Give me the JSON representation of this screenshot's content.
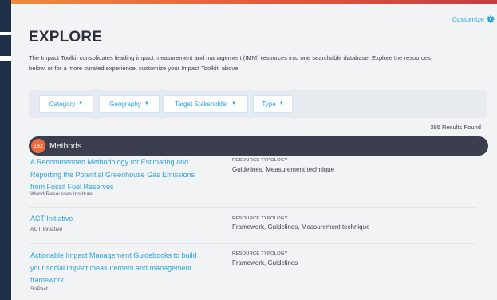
{
  "colors": {
    "accent": "#2aa3d8",
    "header_bar": "#3b3f4d",
    "badge": "#ee6b3f",
    "gradient_start": "#f08a3c",
    "gradient_end": "#c63a46"
  },
  "header": {
    "customize_label": "Customize",
    "customize_icon": "gear-icon"
  },
  "page": {
    "title": "EXPLORE",
    "intro_line1": "The Impact Toolkit consolidates leading impact measurement and management (IMM) resources into one searchable database. Explore the resources",
    "intro_line2": "below, or for a more curated experience, customize your Impact Toolkit, above."
  },
  "filters": [
    {
      "label": "Category"
    },
    {
      "label": "Geography"
    },
    {
      "label": "Target Stakeholder"
    },
    {
      "label": "Type"
    }
  ],
  "results": {
    "count_text": "395 Results Found"
  },
  "section": {
    "count": "182",
    "title": "Methods",
    "typology_label": "RESOURCE TYPOLOGY",
    "items": [
      {
        "title_lines": [
          "A Recommended Methodology for Estimating and",
          "Reporting the Potential Greenhouse Gas Emissions",
          "from Fossil Fuel Reserves"
        ],
        "org": "World Resources Institute",
        "typology": "Guidelines,  Measurement technique"
      },
      {
        "title_lines": [
          "ACT Initiative"
        ],
        "org": "ACT Initiative",
        "typology": "Framework,  Guidelines,  Measurement technique"
      },
      {
        "title_lines": [
          "Actionable Impact Management Guidebooks to build",
          "your social impact measurement and management",
          "framework"
        ],
        "org": "SoPact",
        "typology": "Framework,  Guidelines"
      }
    ]
  }
}
